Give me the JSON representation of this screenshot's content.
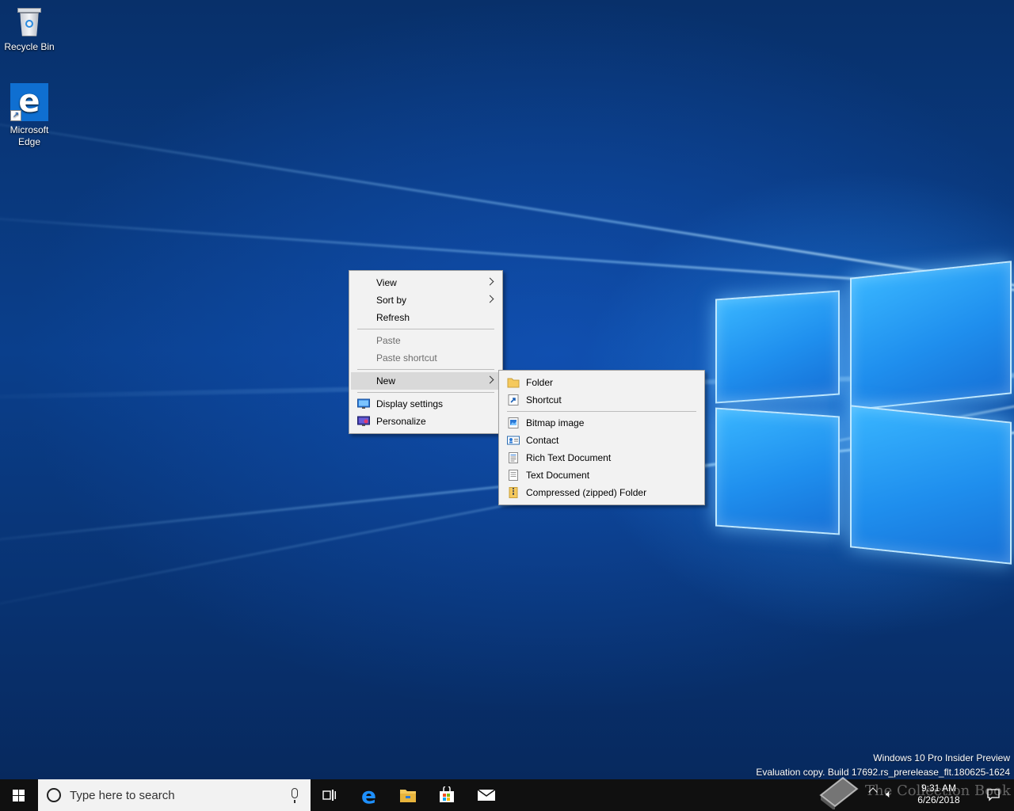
{
  "desktop": {
    "icons": [
      {
        "label": "Recycle Bin",
        "icon": "recycle-bin-icon"
      },
      {
        "label": "Microsoft Edge",
        "icon": "edge-icon"
      }
    ]
  },
  "context_menu": {
    "items": [
      {
        "label": "View",
        "has_submenu": true
      },
      {
        "label": "Sort by",
        "has_submenu": true
      },
      {
        "label": "Refresh"
      },
      {
        "label": "Paste",
        "disabled": true
      },
      {
        "label": "Paste shortcut",
        "disabled": true
      },
      {
        "label": "New",
        "has_submenu": true,
        "highlighted": true
      },
      {
        "label": "Display settings",
        "icon": "display-settings-icon"
      },
      {
        "label": "Personalize",
        "icon": "personalize-icon"
      }
    ]
  },
  "new_submenu": {
    "items": [
      {
        "label": "Folder",
        "icon": "folder-icon"
      },
      {
        "label": "Shortcut",
        "icon": "shortcut-icon"
      },
      {
        "label": "Bitmap image",
        "icon": "bitmap-icon"
      },
      {
        "label": "Contact",
        "icon": "contact-icon"
      },
      {
        "label": "Rich Text Document",
        "icon": "rich-text-icon"
      },
      {
        "label": "Text Document",
        "icon": "text-document-icon"
      },
      {
        "label": "Compressed (zipped) Folder",
        "icon": "zip-folder-icon"
      }
    ]
  },
  "watermark": {
    "line1": "Windows 10 Pro Insider Preview",
    "line2": "Evaluation copy. Build 17692.rs_prerelease_flt.180625-1624"
  },
  "taskbar": {
    "search_placeholder": "Type here to search",
    "clock_time": "9:31 AM",
    "clock_date": "6/26/2018"
  },
  "overlay_text": "The Collection Book",
  "colors": {
    "taskbar": "#101010",
    "menu_bg": "#f2f2f2",
    "highlight": "#d9d9d9"
  }
}
